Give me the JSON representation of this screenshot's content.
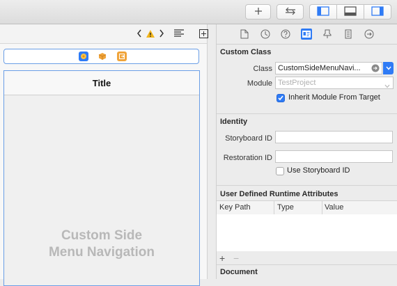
{
  "toolbar": {
    "add_icon": "plus-icon",
    "swap_icon": "swap-arrows-icon",
    "panels": [
      "left-panel-icon",
      "bottom-panel-icon",
      "right-panel-icon"
    ],
    "accent": "#2f7bf5"
  },
  "canvas": {
    "jumpbar_icons": [
      "chevron-left-icon",
      "warning-icon",
      "chevron-right-icon",
      "lines-icon",
      "add-editor-icon"
    ],
    "dock_icons": [
      "view-controller-icon",
      "first-responder-icon",
      "exit-icon"
    ],
    "nav_title": "Title",
    "scene_label_line1": "Custom Side",
    "scene_label_line2": "Menu Navigation"
  },
  "inspector": {
    "tabs": [
      "file-icon",
      "history-icon",
      "help-icon",
      "identity-icon",
      "attributes-icon",
      "size-icon",
      "connections-icon"
    ],
    "custom_class": {
      "header": "Custom Class",
      "class_label": "Class",
      "class_value": "CustomSideMenuNavi...",
      "module_label": "Module",
      "module_placeholder": "TestProject",
      "inherit_label": "Inherit Module From Target",
      "inherit_checked": true
    },
    "identity": {
      "header": "Identity",
      "storyboard_id_label": "Storyboard ID",
      "storyboard_id_value": "",
      "restoration_id_label": "Restoration ID",
      "restoration_id_value": "",
      "use_storyboard_id_label": "Use Storyboard ID",
      "use_storyboard_id_checked": false
    },
    "runtime_attributes": {
      "header": "User Defined Runtime Attributes",
      "columns": [
        "Key Path",
        "Type",
        "Value"
      ],
      "add_label": "+",
      "remove_label": "−"
    },
    "document": {
      "header": "Document"
    }
  }
}
